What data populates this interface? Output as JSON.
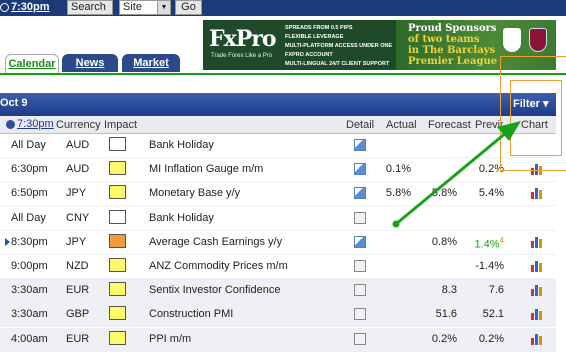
{
  "topbar": {
    "clock": "7:30pm",
    "search_label": "Search",
    "site_select": "Site",
    "go_label": "Go"
  },
  "ad": {
    "logo": "FxPro",
    "tagline": "Trade Forex Like a Pro",
    "bullets": [
      "SPREADS FROM 0.5 PIPS",
      "FLEXIBLE LEVERAGE",
      "MULTI-PLATFORM ACCESS UNDER ONE",
      "FXPRO ACCOUNT",
      "MULTI-LINGUAL 24/7 CLIENT SUPPORT"
    ],
    "proud_line1": "Proud Sponsors",
    "proud_line2": "of two teams",
    "proud_line3": "in The Barclays",
    "proud_line4": "Premier League"
  },
  "tabs": {
    "calendar": "Calendar",
    "news": "News",
    "market": "Market"
  },
  "date_bar": {
    "date": "Oct 9",
    "filter": "Filter ▾"
  },
  "columns": {
    "time": "7:30pm",
    "currency": "Currency",
    "impact": "Impact",
    "detail": "Detail",
    "actual": "Actual",
    "forecast": "Forecast",
    "previous": "Previous",
    "chart": "Chart"
  },
  "rows": [
    {
      "time": "All Day",
      "currency": "AUD",
      "impact": "none",
      "event": "Bank Holiday",
      "detail": "blue",
      "actual": "",
      "forecast": "",
      "previous": "",
      "chart": false
    },
    {
      "time": "6:30pm",
      "currency": "AUD",
      "impact": "low",
      "event": "MI Inflation Gauge m/m",
      "detail": "blue",
      "actual": "0.1%",
      "forecast": "",
      "previous": "0.2%",
      "chart": true
    },
    {
      "time": "6:50pm",
      "currency": "JPY",
      "impact": "low",
      "event": "Monetary Base y/y",
      "detail": "blue",
      "actual": "5.8%",
      "forecast": "5.8%",
      "previous": "5.4%",
      "chart": true
    },
    {
      "time": "All Day",
      "currency": "CNY",
      "impact": "none",
      "event": "Bank Holiday",
      "detail": "gray",
      "actual": "",
      "forecast": "",
      "previous": "",
      "chart": false
    },
    {
      "time": "8:30pm",
      "currency": "JPY",
      "impact": "med",
      "event": "Average Cash Earnings y/y",
      "detail": "blue",
      "actual": "",
      "forecast": "0.8%",
      "previous": "1.4%",
      "previous_revised": true,
      "chart": true
    },
    {
      "time": "9:00pm",
      "currency": "NZD",
      "impact": "low",
      "event": "ANZ Commodity Prices m/m",
      "detail": "gray",
      "actual": "",
      "forecast": "",
      "previous": "-1.4%",
      "chart": true
    },
    {
      "time": "3:30am",
      "currency": "EUR",
      "impact": "low",
      "event": "Sentix Investor Confidence",
      "detail": "gray",
      "actual": "",
      "forecast": "8.3",
      "previous": "7.6",
      "chart": true
    },
    {
      "time": "3:30am",
      "currency": "GBP",
      "impact": "low",
      "event": "Construction PMI",
      "detail": "gray",
      "actual": "",
      "forecast": "51.6",
      "previous": "52.1",
      "chart": true
    },
    {
      "time": "4:00am",
      "currency": "EUR",
      "impact": "low",
      "event": "PPI m/m",
      "detail": "gray",
      "actual": "",
      "forecast": "0.2%",
      "previous": "0.2%",
      "chart": true
    }
  ],
  "colors": {
    "header_blue": "#1d3b86",
    "accent_green": "#17a21a",
    "annotation_orange": "#f0a030",
    "impact_low": "#fffa6a",
    "impact_med": "#f29b3b"
  }
}
